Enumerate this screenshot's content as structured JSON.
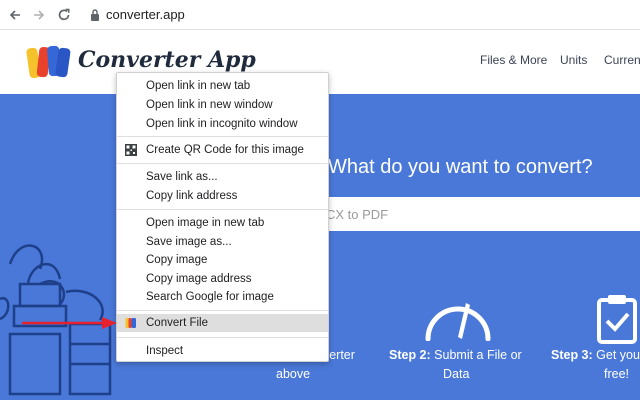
{
  "browser": {
    "url": "converter.app"
  },
  "site": {
    "logo_text": "Converter App",
    "nav": [
      "Files & More",
      "Units",
      "Curren"
    ]
  },
  "hero": {
    "title": "What do you want to convert?",
    "search_placeholder": "CX to PDF",
    "step1_line1": "nverter",
    "step1_line2": "above",
    "step2_label": "Step 2:",
    "step2_text": " Submit a File or",
    "step2_line2": "Data",
    "step3_label": "Step 3:",
    "step3_text": " Get you",
    "step3_line2": "free!"
  },
  "context_menu": {
    "items": [
      "Open link in new tab",
      "Open link in new window",
      "Open link in incognito window",
      "Create QR Code for this image",
      "Save link as...",
      "Copy link address",
      "Open image in new tab",
      "Save image as...",
      "Copy image",
      "Copy image address",
      "Search Google for image",
      "Convert File",
      "Inspect"
    ]
  },
  "colors": {
    "hero_bg": "#4a78d8",
    "arrow": "#e8212e",
    "highlight": "#dedede"
  }
}
